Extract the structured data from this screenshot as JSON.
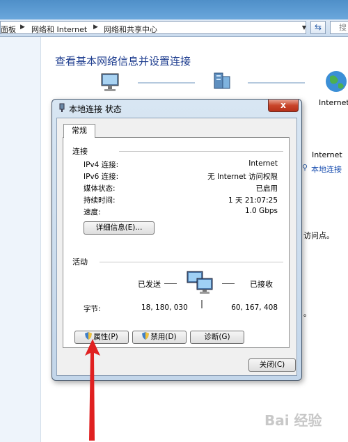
{
  "address_bar": {
    "crumbs": [
      "面板",
      "网络和 Internet",
      "网络和共享中心"
    ],
    "search_placeholder": "搜"
  },
  "main": {
    "title": "查看基本网络信息并设置连接",
    "internet_label": "Internet",
    "right_internet_label": "Internet",
    "right_connection_link": "本地连接",
    "right_text_access_point": "访问点。",
    "right_text_period": "。"
  },
  "dialog": {
    "title": "本地连接 状态",
    "close_label": "x",
    "tab_general": "常规",
    "connection_group": "连接",
    "rows": [
      {
        "label": "IPv4 连接:",
        "value": "Internet"
      },
      {
        "label": "IPv6 连接:",
        "value": "无 Internet 访问权限"
      },
      {
        "label": "媒体状态:",
        "value": "已启用"
      },
      {
        "label": "持续时间:",
        "value": "1 天 21:07:25"
      },
      {
        "label": "速度:",
        "value": "1.0 Gbps"
      }
    ],
    "details_button": "详细信息(E)...",
    "activity_group": "活动",
    "sent_label": "已发送",
    "received_label": "已接收",
    "bytes_label": "字节:",
    "bytes_sent": "18, 180, 030",
    "bytes_received": "60, 167, 408",
    "properties_button": "属性(P)",
    "disable_button": "禁用(D)",
    "diagnose_button": "诊断(G)",
    "close_button": "关闭(C)"
  },
  "watermark": "Bai 经验",
  "colors": {
    "accent_title": "#1e3d8f",
    "arrow": "#e02020",
    "close_red": "#c9452a"
  }
}
